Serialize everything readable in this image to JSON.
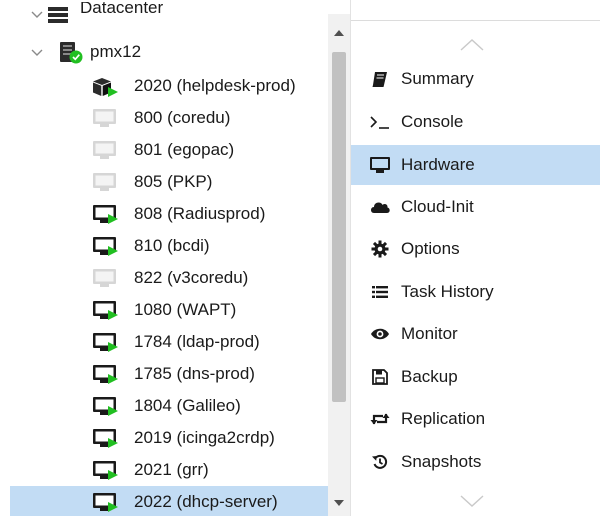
{
  "tree": {
    "datacenter": {
      "label": "Datacenter",
      "icon": "datacenter-icon"
    },
    "node": {
      "label": "pmx12",
      "status": "online",
      "icon": "server-node-icon"
    },
    "guests": [
      {
        "label": "2020 (helpdesk-prod)",
        "icon": "container-running-icon",
        "state": "running"
      },
      {
        "label": "800 (coredu)",
        "icon": "vm-stopped-icon",
        "state": "stopped"
      },
      {
        "label": "801 (egopac)",
        "icon": "vm-stopped-icon",
        "state": "stopped"
      },
      {
        "label": "805 (PKP)",
        "icon": "vm-stopped-icon",
        "state": "stopped"
      },
      {
        "label": "808 (Radiusprod)",
        "icon": "vm-running-icon",
        "state": "running"
      },
      {
        "label": "810 (bcdi)",
        "icon": "vm-running-icon",
        "state": "running"
      },
      {
        "label": "822 (v3coredu)",
        "icon": "vm-stopped-icon",
        "state": "stopped"
      },
      {
        "label": "1080 (WAPT)",
        "icon": "vm-running-icon",
        "state": "running"
      },
      {
        "label": "1784 (ldap-prod)",
        "icon": "vm-running-icon",
        "state": "running"
      },
      {
        "label": "1785 (dns-prod)",
        "icon": "vm-running-icon",
        "state": "running"
      },
      {
        "label": "1804 (Galileo)",
        "icon": "vm-running-icon",
        "state": "running"
      },
      {
        "label": "2019 (icinga2crdp)",
        "icon": "vm-running-icon",
        "state": "running"
      },
      {
        "label": "2021 (grr)",
        "icon": "vm-running-icon",
        "state": "running"
      },
      {
        "label": "2022 (dhcp-server)",
        "icon": "vm-running-icon",
        "state": "running",
        "selected": true
      }
    ]
  },
  "menu": {
    "items": [
      {
        "label": "Summary",
        "icon": "book-icon"
      },
      {
        "label": "Console",
        "icon": "terminal-icon"
      },
      {
        "label": "Hardware",
        "icon": "desktop-icon",
        "selected": true
      },
      {
        "label": "Cloud-Init",
        "icon": "cloud-icon"
      },
      {
        "label": "Options",
        "icon": "gear-icon"
      },
      {
        "label": "Task History",
        "icon": "list-icon"
      },
      {
        "label": "Monitor",
        "icon": "eye-icon"
      },
      {
        "label": "Backup",
        "icon": "floppy-icon"
      },
      {
        "label": "Replication",
        "icon": "retweet-icon"
      },
      {
        "label": "Snapshots",
        "icon": "history-icon"
      }
    ]
  },
  "colors": {
    "selection": "#c2dcf4",
    "running": "#21bf21",
    "stopped_monitor": "#d6d6d6",
    "icon_dark": "#1a1a1a"
  }
}
